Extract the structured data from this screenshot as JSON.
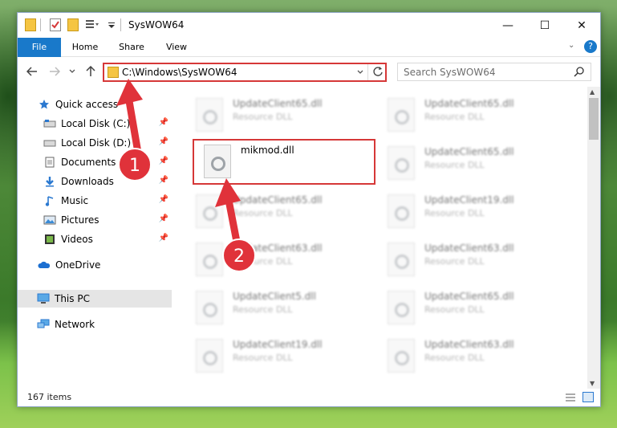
{
  "window": {
    "title": "SysWOW64",
    "minimize_glyph": "—",
    "maximize_glyph": "☐",
    "close_glyph": "✕"
  },
  "ribbon": {
    "tabs": [
      {
        "label": "File"
      },
      {
        "label": "Home"
      },
      {
        "label": "Share"
      },
      {
        "label": "View"
      }
    ],
    "help_glyph": "?"
  },
  "address": {
    "path": "C:\\Windows\\SysWOW64"
  },
  "search": {
    "placeholder": "Search SysWOW64"
  },
  "nav": {
    "items": [
      {
        "label": "Quick access",
        "icon": "star-icon"
      },
      {
        "label": "Local Disk (C:)",
        "icon": "drive-icon",
        "pinned": true
      },
      {
        "label": "Local Disk (D:)",
        "icon": "drive-icon",
        "pinned": true
      },
      {
        "label": "Documents",
        "icon": "documents-icon",
        "pinned": true
      },
      {
        "label": "Downloads",
        "icon": "downloads-icon",
        "pinned": true
      },
      {
        "label": "Music",
        "icon": "music-icon",
        "pinned": true
      },
      {
        "label": "Pictures",
        "icon": "pictures-icon",
        "pinned": true
      },
      {
        "label": "Videos",
        "icon": "videos-icon",
        "pinned": true
      },
      {
        "label": "OneDrive",
        "icon": "onedrive-icon"
      },
      {
        "label": "This PC",
        "icon": "pc-icon",
        "selected": true
      },
      {
        "label": "Network",
        "icon": "network-icon"
      }
    ]
  },
  "files": [
    {
      "name": "UpdateClient65.dll",
      "type": "Resource DLL"
    },
    {
      "name": "UpdateClient65.dll",
      "type": "Resource DLL"
    },
    {
      "name": "mikmod.dll",
      "type": ""
    },
    {
      "name": "UpdateClient65.dll",
      "type": "Resource DLL"
    },
    {
      "name": "UpdateClient65.dll",
      "type": "Resource DLL"
    },
    {
      "name": "UpdateClient19.dll",
      "type": "Resource DLL"
    },
    {
      "name": "UpdateClient63.dll",
      "type": "Resource DLL"
    },
    {
      "name": "UpdateClient63.dll",
      "type": "Resource DLL"
    },
    {
      "name": "UpdateClient5.dll",
      "type": "Resource DLL"
    },
    {
      "name": "UpdateClient65.dll",
      "type": "Resource DLL"
    },
    {
      "name": "UpdateClient19.dll",
      "type": "Resource DLL"
    },
    {
      "name": "UpdateClient63.dll",
      "type": "Resource DLL"
    }
  ],
  "status": {
    "item_count": "167 items"
  },
  "annotations": {
    "badge1": "1",
    "badge2": "2"
  },
  "colors": {
    "accent": "#1979ca",
    "highlight_red": "#d63838",
    "annotation_red": "#e0323a"
  }
}
